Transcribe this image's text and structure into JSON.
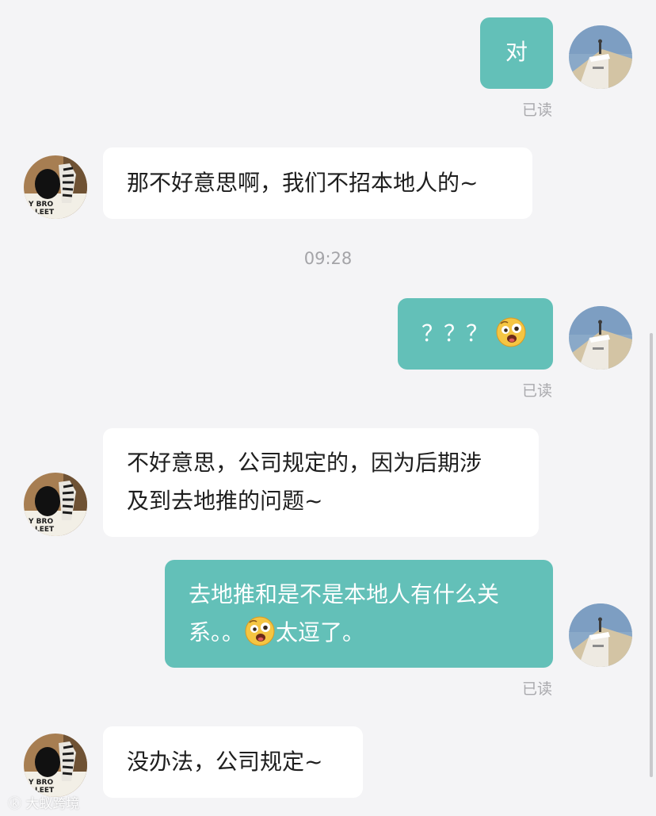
{
  "conversation": {
    "messages": [
      {
        "id": "m1",
        "side": "out",
        "text": "对",
        "read_label": "已读"
      },
      {
        "id": "m2",
        "side": "in",
        "text": "那不好意思啊，我们不招本地人的~"
      },
      {
        "id": "ts1",
        "type": "timestamp",
        "text": "09:28"
      },
      {
        "id": "m3",
        "side": "out",
        "text": "？？？",
        "emoji": "dizzy-face-emoji",
        "read_label": "已读"
      },
      {
        "id": "m4",
        "side": "in",
        "line1": "不好意思，公司规定的，因为后期涉",
        "line2": "及到去地推的问题~"
      },
      {
        "id": "m5",
        "side": "out",
        "line1": "去地推和是不是本地人有什么关",
        "line2_pre": "系。。",
        "line2_emoji": "dizzy-face-emoji",
        "line2_post": "太逗了。",
        "read_label": "已读"
      },
      {
        "id": "m6",
        "side": "in",
        "text": "没办法，公司规定~"
      }
    ]
  },
  "watermark": {
    "text": "大蚁跨境"
  },
  "colors": {
    "background": "#f4f4f6",
    "outgoing_bubble": "#63c0b8",
    "incoming_bubble": "#ffffff",
    "read_label": "#a9a9ad"
  }
}
